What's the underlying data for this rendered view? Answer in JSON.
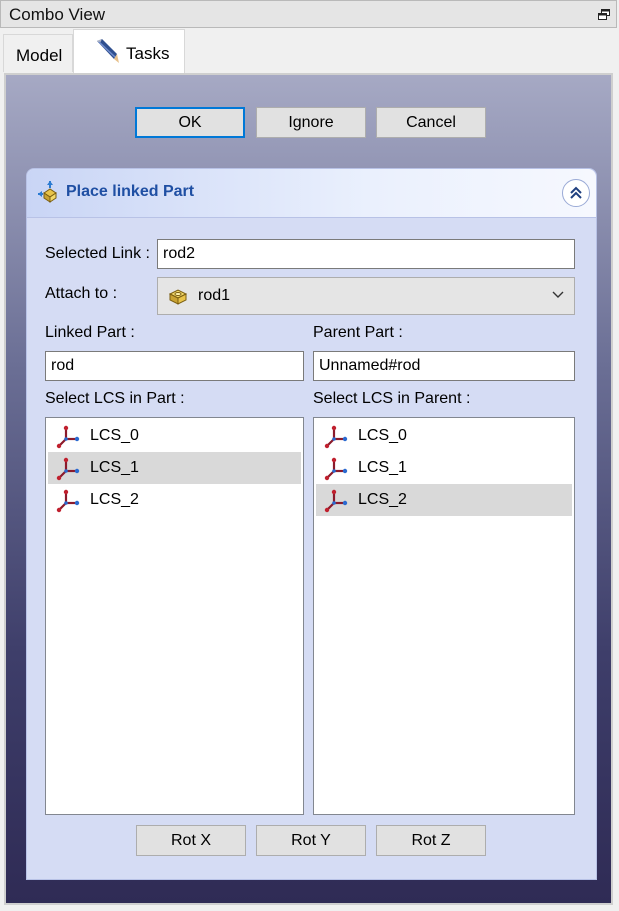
{
  "window": {
    "title": "Combo View"
  },
  "tabs": {
    "model": "Model",
    "tasks": "Tasks"
  },
  "dialog_buttons": {
    "ok": "OK",
    "ignore": "Ignore",
    "cancel": "Cancel"
  },
  "panel": {
    "title": "Place linked Part",
    "selected_link_label": "Selected Link :",
    "selected_link_value": "rod2",
    "attach_to_label": "Attach to :",
    "attach_to_value": "rod1",
    "linked_part_label": "Linked Part :",
    "linked_part_value": "rod",
    "parent_part_label": "Parent Part :",
    "parent_part_value": "Unnamed#rod",
    "lcs_part_label": "Select LCS in Part :",
    "lcs_parent_label": "Select LCS in Parent :",
    "lcs_part_items": [
      "LCS_0",
      "LCS_1",
      "LCS_2"
    ],
    "lcs_part_selected": 1,
    "lcs_parent_items": [
      "LCS_0",
      "LCS_1",
      "LCS_2"
    ],
    "lcs_parent_selected": 2,
    "rot_buttons": {
      "x": "Rot X",
      "y": "Rot Y",
      "z": "Rot Z"
    }
  },
  "colors": {
    "accent": "#0078d7",
    "panel_title": "#1f4fa3",
    "lcs_icon": "#8b1a2b"
  }
}
